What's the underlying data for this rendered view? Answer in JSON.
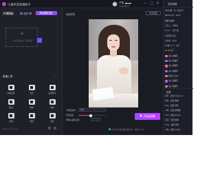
{
  "app": {
    "title": "小莫声音视频助手",
    "username": "子宝",
    "user_sub": "00000000",
    "window_controls": [
      "—",
      "□",
      "✕"
    ]
  },
  "left": {
    "start_live_tab": "开播模板",
    "modes": [
      {
        "label": "竖屏",
        "selected": true
      },
      {
        "label": "横屏",
        "selected": false
      }
    ],
    "mode_button": "添加直播文案",
    "add_source_hint": "点击添加素材，开始直播",
    "tools_header": "直播工具",
    "tools_more": "›",
    "tools": [
      {
        "label": "直播设置"
      },
      {
        "label": "连麦"
      },
      {
        "label": "主播任务"
      },
      {
        "label": "贴纸"
      },
      {
        "label": "特效"
      },
      {
        "label": "美颜"
      },
      {
        "label": "音效"
      },
      {
        "label": "弹幕"
      },
      {
        "label": "更多"
      }
    ],
    "version": "Version 4.5.30"
  },
  "center": {
    "preview_label": "画面预览",
    "refresh_button": "重置画面",
    "settings": {
      "quality_label": "清晰度选择",
      "quality_value": "超清",
      "volume_label": "音量设置",
      "volume_level": 0.45,
      "mic_label": "摄像头美颜设置"
    },
    "start_button": "开始直播",
    "status_text": "正在与云端直播间连接中 · 分组4.5.02"
  },
  "right": {
    "title": "互动消息",
    "chat": [
      {
        "tag": "",
        "text": "Nadia说：Hi！晚上好"
      },
      {
        "tag": "",
        "text": "Miles7ry2：Yes!!!"
      },
      {
        "tag": "",
        "text": "福利大放送"
      },
      {
        "tag": "",
        "text": "小王二：大家好"
      },
      {
        "tag": "",
        "text": "Luna：一起一起"
      },
      {
        "tag": "",
        "text": "小张同学 来了"
      },
      {
        "tag": "",
        "text": "点点好（小心）"
      },
      {
        "tag": "",
        "text": "AC酱^0^/~ 来了"
      },
      {
        "tag": "",
        "text": "Linda 来了"
      },
      {
        "tag": "pink",
        "text": "进入直播间"
      },
      {
        "tag": "purple",
        "text": "进入直播间"
      },
      {
        "tag": "pink",
        "text": "进入直播间"
      },
      {
        "tag": "purple",
        "text": "进入直播间"
      },
      {
        "tag": "pink",
        "text": "送出 小心心"
      },
      {
        "tag": "purple",
        "text": "进入直播间"
      },
      {
        "tag": "pink",
        "text": "进入直播间"
      }
    ],
    "mid_title": "礼物",
    "gifts": [
      {
        "text": "用户：送出 小心心 x1"
      },
      {
        "text": "某某：送出 玫瑰"
      },
      {
        "text": "Lisa：送出 鲜花"
      },
      {
        "text": "小可：送出 棒棒糖"
      },
      {
        "text": "Tom：送出 小心心"
      },
      {
        "text": "豆豆：送出 玫瑰"
      },
      {
        "text": "Amy：送出 鲜花"
      },
      {
        "text": "小鱼：送出 小心心"
      }
    ]
  }
}
